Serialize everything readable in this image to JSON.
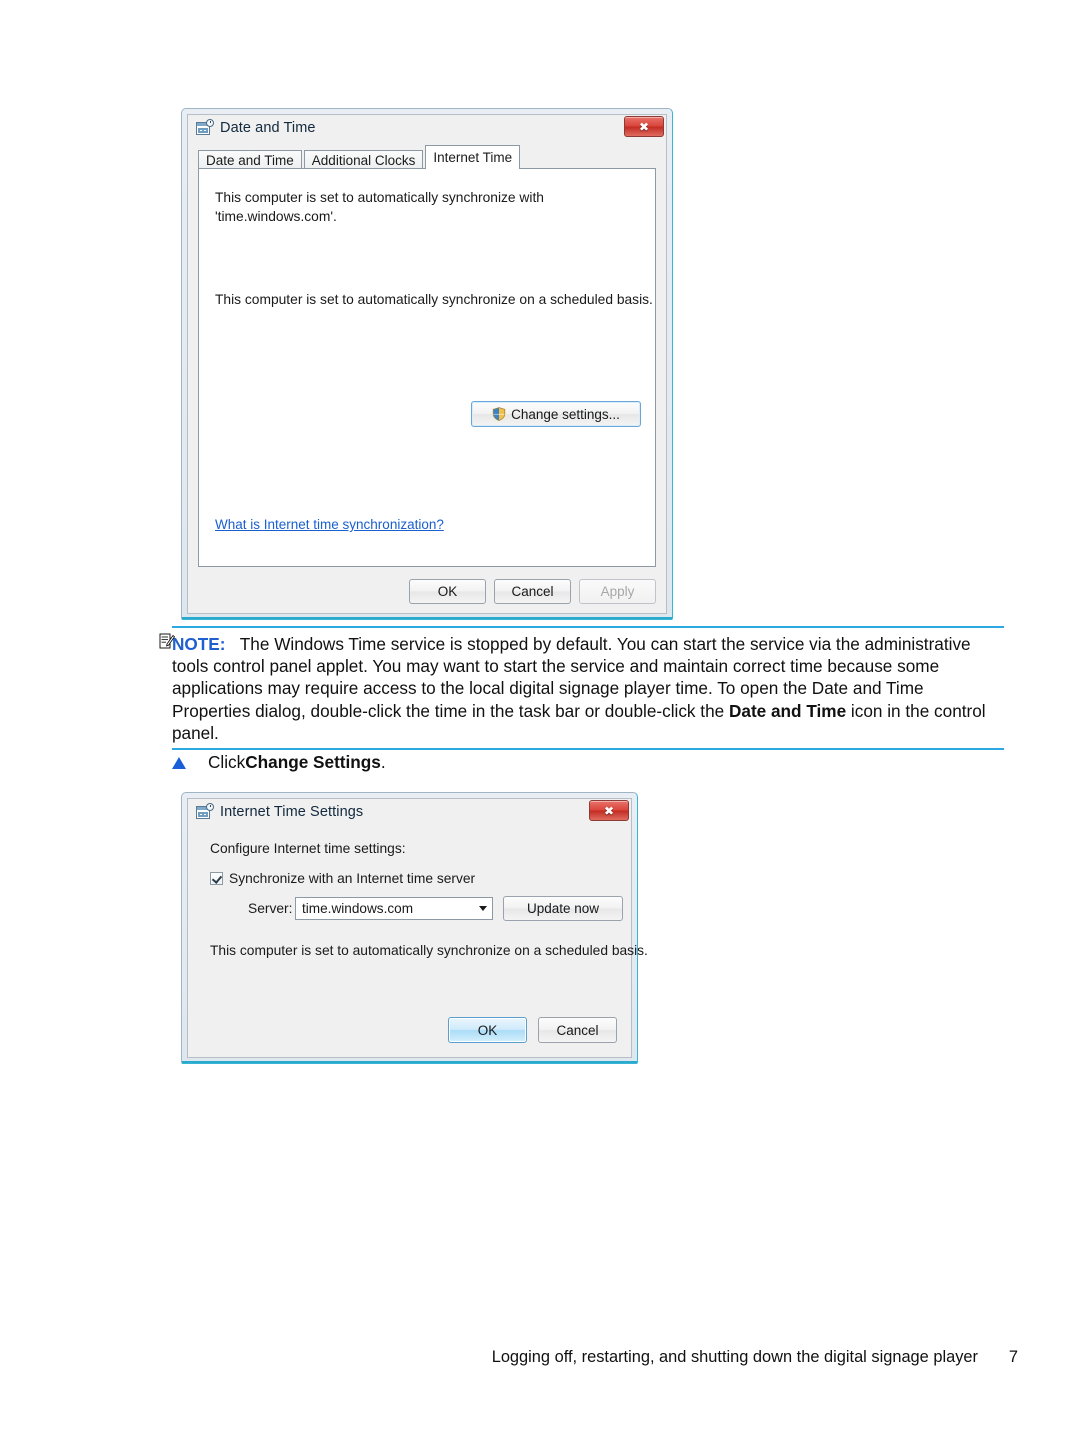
{
  "dialog1": {
    "title": "Date and Time",
    "icon": "calendar-clock-icon",
    "close_glyph": "✖",
    "tabs": [
      {
        "label": "Date and Time",
        "active": false
      },
      {
        "label": "Additional Clocks",
        "active": false
      },
      {
        "label": "Internet Time",
        "active": true
      }
    ],
    "body_line1": "This computer is set to automatically synchronize with",
    "body_line2": "'time.windows.com'.",
    "body_line3": "This computer is set to automatically synchronize on a scheduled basis.",
    "change_settings_label": "Change settings...",
    "help_link": "What is Internet time synchronization?",
    "buttons": {
      "ok": "OK",
      "cancel": "Cancel",
      "apply": "Apply"
    }
  },
  "note": {
    "label": "NOTE:",
    "icon": "note-pencil-icon",
    "text_part1": "The Windows Time service is stopped by default. You can start the service via the administrative tools control panel applet. You may want to start the service and maintain correct time because some applications may require access to the local digital signage player time. To open the Date and Time Properties dialog, double-click the time in the task bar or double-click the ",
    "bold_phrase": "Date and Time",
    "text_part2": " icon in the control panel."
  },
  "step": {
    "bullet": "triangle-bullet-icon",
    "prefix": "Click ",
    "bold": "Change Settings",
    "suffix": "."
  },
  "dialog2": {
    "title": "Internet Time Settings",
    "icon": "calendar-clock-icon",
    "close_glyph": "✖",
    "heading": "Configure Internet time settings:",
    "checkbox_label": "Synchronize with an Internet time server",
    "checkbox_checked": true,
    "server_label": "Server:",
    "server_value": "time.windows.com",
    "update_now_label": "Update now",
    "status_text": "This computer is set to automatically synchronize on a scheduled basis.",
    "buttons": {
      "ok": "OK",
      "cancel": "Cancel"
    }
  },
  "footer": {
    "text": "Logging off, restarting, and shutting down the digital signage player",
    "page": "7"
  },
  "colors": {
    "accent_blue": "#2aa9e0",
    "link_blue": "#1a5fcf",
    "note_label_blue": "#1f5fd0",
    "bullet_blue": "#1a5fd8",
    "close_red": "#d9453b"
  }
}
